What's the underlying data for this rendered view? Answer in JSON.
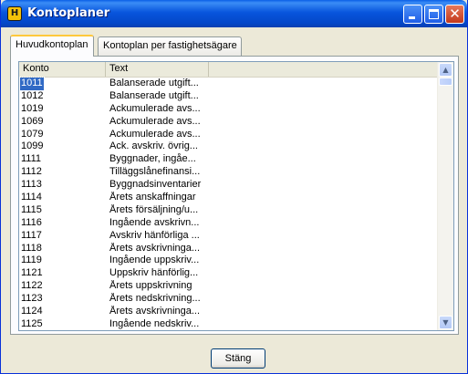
{
  "window": {
    "title": "Kontoplaner",
    "app_icon_letter": "H"
  },
  "tabs": [
    {
      "label": "Huvudkontoplan",
      "active": true
    },
    {
      "label": "Kontoplan per fastighetsägare",
      "active": false
    }
  ],
  "list": {
    "columns": [
      "Konto",
      "Text",
      ""
    ],
    "selected_row": 0,
    "rows": [
      {
        "konto": "1011",
        "text": "Balanserade utgift..."
      },
      {
        "konto": "1012",
        "text": "Balanserade utgift..."
      },
      {
        "konto": "1019",
        "text": "Ackumulerade avs..."
      },
      {
        "konto": "1069",
        "text": "Ackumulerade avs..."
      },
      {
        "konto": "1079",
        "text": "Ackumulerade avs..."
      },
      {
        "konto": "1099",
        "text": "Ack. avskriv. övrig..."
      },
      {
        "konto": "1111",
        "text": "Byggnader, ingåe..."
      },
      {
        "konto": "1112",
        "text": "Tilläggslånefinansi..."
      },
      {
        "konto": "1113",
        "text": "Byggnadsinventarier"
      },
      {
        "konto": "1114",
        "text": "Årets anskaffningar"
      },
      {
        "konto": "1115",
        "text": "Årets försäljning/u..."
      },
      {
        "konto": "1116",
        "text": "Ingående avskrivn..."
      },
      {
        "konto": "1117",
        "text": "Avskriv hänförliga ..."
      },
      {
        "konto": "1118",
        "text": "Årets avskrivninga..."
      },
      {
        "konto": "1119",
        "text": "Ingående uppskriv..."
      },
      {
        "konto": "1121",
        "text": "Uppskriv hänförlig..."
      },
      {
        "konto": "1122",
        "text": "Årets uppskrivning"
      },
      {
        "konto": "1123",
        "text": "Årets nedskrivning..."
      },
      {
        "konto": "1124",
        "text": "Årets avskrivninga..."
      },
      {
        "konto": "1125",
        "text": "Ingående nedskriv..."
      }
    ]
  },
  "buttons": {
    "close_label": "Stäng"
  },
  "colors": {
    "selection": "#316ac5",
    "titlebar": "#0855dd",
    "close_button": "#c3391c"
  }
}
